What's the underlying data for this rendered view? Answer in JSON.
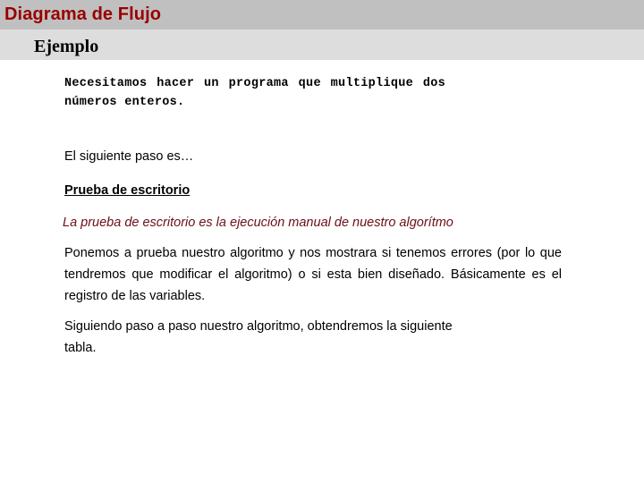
{
  "slide": {
    "title": "Diagrama de Flujo",
    "subtitle": "Ejemplo",
    "colors": {
      "title_band": "#c0c0c0",
      "subtitle_band": "#dddddd",
      "title_text": "#990000",
      "accent_italic": "#6b0f16",
      "body_text": "#000000",
      "page_background": "#ffffff"
    },
    "body": {
      "problem_statement_line1": "Necesitamos hacer un programa que multiplique dos",
      "problem_statement_line2": "números enteros.",
      "next_step": "El siguiente paso es…",
      "section_heading": "Prueba de escritorio",
      "definition": "La prueba de escritorio es la ejecución manual de nuestro algorítmo",
      "paragraph_one": "Ponemos a prueba nuestro algoritmo y nos mostrara si tenemos errores (por lo que tendremos que modificar el algoritmo) o si esta bien diseñado. Básicamente es el registro de las variables.",
      "paragraph_two_main": "Siguiendo paso a paso nuestro algoritmo, obtendremos la siguiente",
      "paragraph_two_tail": "tabla."
    }
  }
}
